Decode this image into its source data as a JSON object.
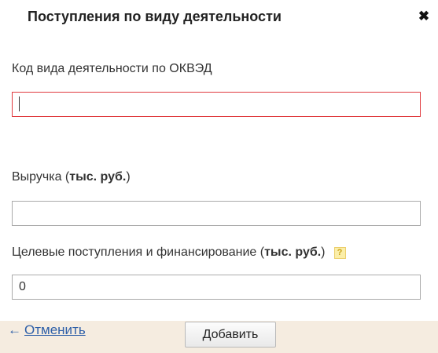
{
  "dialog": {
    "title": "Поступления по виду деятельности",
    "close_icon": "close-icon"
  },
  "fields": {
    "okved": {
      "label": "Код вида деятельности по ОКВЭД",
      "value": "",
      "error_color": "#e0393e"
    },
    "revenue": {
      "label": "Выручка",
      "unit": "тыс. руб.",
      "value": ""
    },
    "target_income": {
      "label": "Целевые поступления и финансирование",
      "unit": "тыс. руб.",
      "help_icon": "question-mark-icon",
      "help_text": "?",
      "value": "0"
    }
  },
  "footer": {
    "cancel_arrow": "←",
    "cancel_label": "Отменить",
    "add_label": "Добавить",
    "background": "#f5ece0",
    "link_color": "#2e5fa8"
  }
}
